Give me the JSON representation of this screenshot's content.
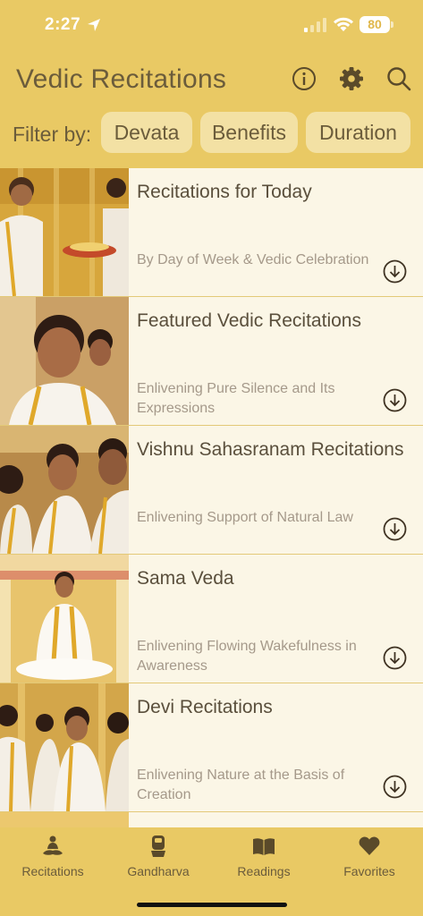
{
  "status": {
    "time": "2:27",
    "battery": "80"
  },
  "header": {
    "title": "Vedic Recitations"
  },
  "filter": {
    "label": "Filter by:",
    "chips": [
      "Devata",
      "Benefits",
      "Duration"
    ]
  },
  "items": [
    {
      "title": "Recitations for Today",
      "subtitle": "By Day of Week & Vedic Celebration"
    },
    {
      "title": "Featured Vedic Recitations",
      "subtitle": "Enlivening Pure Silence and Its Expressions"
    },
    {
      "title": "Vishnu Sahasranam Recitations",
      "subtitle": "Enlivening Support of Natural Law"
    },
    {
      "title": "Sama Veda",
      "subtitle": "Enlivening Flowing Wakefulness in Awareness"
    },
    {
      "title": "Devi Recitations",
      "subtitle": "Enlivening Nature at the Basis of Creation"
    }
  ],
  "tabs": [
    {
      "label": "Recitations",
      "icon": "meditator-icon"
    },
    {
      "label": "Gandharva",
      "icon": "drum-icon"
    },
    {
      "label": "Readings",
      "icon": "book-icon"
    },
    {
      "label": "Favorites",
      "icon": "heart-icon"
    }
  ],
  "colors": {
    "background": "#e9c964",
    "chip": "#f3e1a4",
    "list": "#fbf6e6",
    "text": "#6b5c3b"
  }
}
